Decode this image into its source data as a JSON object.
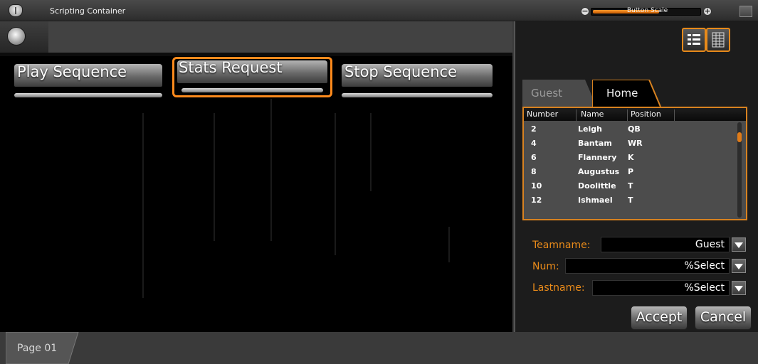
{
  "window": {
    "title": "Scripting Container",
    "icon": "app-icon",
    "button_scale_label": "Button Scale",
    "button_scale_value": 0.62,
    "accent_color": "#ff8a1c"
  },
  "sequence_buttons": [
    {
      "label": "Play Sequence",
      "selected": false
    },
    {
      "label": "Stats Request",
      "selected": true
    },
    {
      "label": "Stop Sequence",
      "selected": false
    }
  ],
  "page_tabs": [
    {
      "label": "Page 01"
    }
  ],
  "right_panel": {
    "view_buttons": [
      "list-view-icon",
      "grid-view-icon"
    ],
    "team_tabs": [
      {
        "label": "Guest",
        "active": false
      },
      {
        "label": "Home",
        "active": true
      }
    ],
    "roster": {
      "columns": [
        "Number",
        "Name",
        "Position"
      ],
      "rows": [
        [
          "2",
          "Leigh",
          "QB"
        ],
        [
          "4",
          "Bantam",
          "WR"
        ],
        [
          "6",
          "Flannery",
          "K"
        ],
        [
          "8",
          "Augustus",
          "P"
        ],
        [
          "10",
          "Doolittle",
          "T"
        ],
        [
          "12",
          "Ishmael",
          "T"
        ]
      ]
    },
    "fields": {
      "teamname": {
        "label": "Teamname:",
        "value": "Guest"
      },
      "num": {
        "label": "Num:",
        "value": "%Select"
      },
      "lastname": {
        "label": "Lastname:",
        "value": "%Select"
      }
    },
    "actions": {
      "accept": "Accept",
      "cancel": "Cancel"
    }
  }
}
